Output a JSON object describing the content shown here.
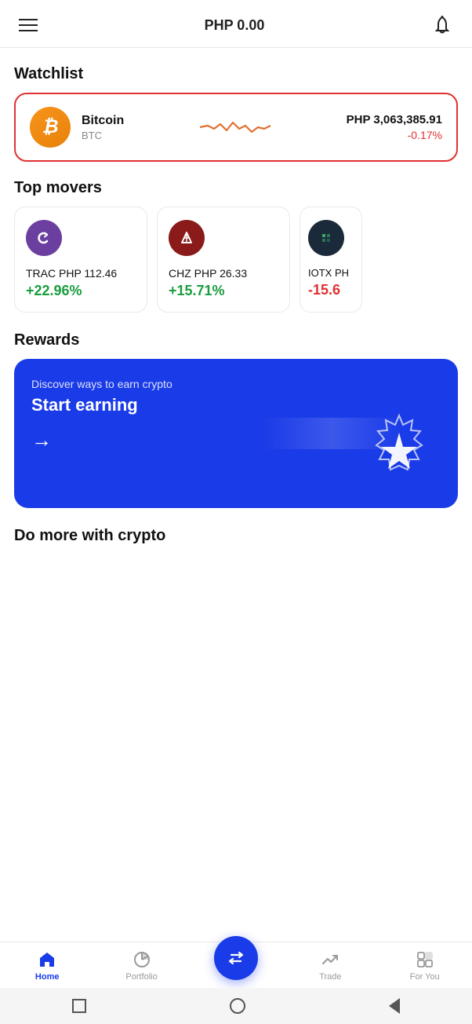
{
  "header": {
    "balance": "PHP 0.00",
    "menu_label": "menu",
    "bell_label": "notifications"
  },
  "watchlist": {
    "section_title": "Watchlist",
    "item": {
      "name": "Bitcoin",
      "ticker": "BTC",
      "price": "PHP 3,063,385.91",
      "change": "-0.17%"
    }
  },
  "top_movers": {
    "section_title": "Top movers",
    "items": [
      {
        "ticker": "TRAC",
        "price": "PHP 112.46",
        "change": "+22.96%",
        "change_type": "positive",
        "icon_color": "#6b3fa0"
      },
      {
        "ticker": "CHZ",
        "price": "PHP 26.33",
        "change": "+15.71%",
        "change_type": "positive",
        "icon_color": "#8b1a1a"
      },
      {
        "ticker": "IOTX",
        "price": "PH...",
        "change": "-15.6",
        "change_type": "negative",
        "icon_color": "#1a2a3a"
      }
    ]
  },
  "rewards": {
    "section_title": "Rewards",
    "subtitle": "Discover ways to earn crypto",
    "title": "Start earning",
    "arrow": "→"
  },
  "do_more": {
    "section_title": "Do more with crypto"
  },
  "bottom_nav": {
    "items": [
      {
        "label": "Home",
        "active": true
      },
      {
        "label": "Portfolio",
        "active": false
      },
      {
        "label": "swap",
        "active": false
      },
      {
        "label": "Trade",
        "active": false
      },
      {
        "label": "For You",
        "active": false
      }
    ]
  },
  "android_nav": {
    "square": "□",
    "circle": "○",
    "back": "◁"
  }
}
